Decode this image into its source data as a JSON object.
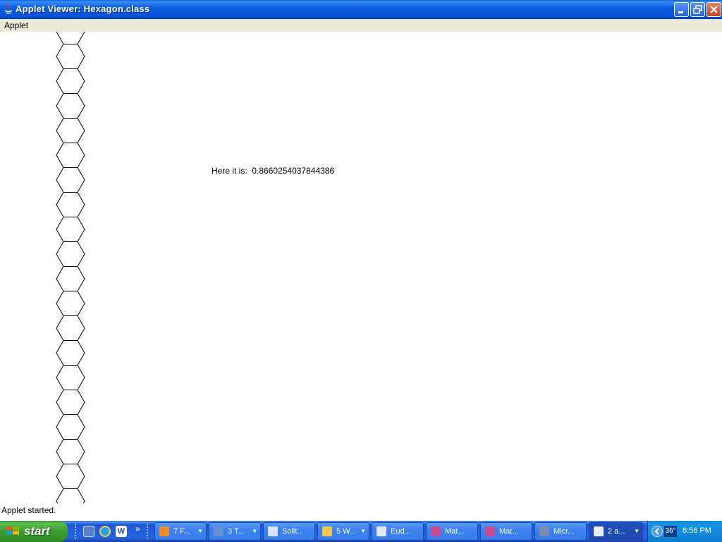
{
  "window": {
    "title": "Applet Viewer: Hexagon.class"
  },
  "menu": {
    "items": [
      "Applet"
    ]
  },
  "applet": {
    "readout_label": "Here it is:",
    "readout_value": "0.8660254037844386"
  },
  "status": {
    "text": "Applet started."
  },
  "taskbar": {
    "start_label": "start",
    "quick_launch": [
      "media-icon",
      "ie-icon",
      "word-icon"
    ],
    "chevron": "»",
    "buttons": [
      {
        "label": "7 F...",
        "icon": "firefox-icon",
        "has_arrow": true
      },
      {
        "label": "3 T...",
        "icon": "terminal-icon",
        "has_arrow": true
      },
      {
        "label": "Solit...",
        "icon": "solitaire-icon",
        "has_arrow": false
      },
      {
        "label": "5 W...",
        "icon": "folder-icon",
        "has_arrow": true
      },
      {
        "label": "Eud...",
        "icon": "eudora-icon",
        "has_arrow": false
      },
      {
        "label": "Mat...",
        "icon": "matlab-icon",
        "has_arrow": false
      },
      {
        "label": "Mat...",
        "icon": "matlab-icon",
        "has_arrow": false
      },
      {
        "label": "Micr...",
        "icon": "app-icon",
        "has_arrow": false
      },
      {
        "label": "2 a...",
        "icon": "window-icon",
        "has_arrow": true
      }
    ],
    "tray": {
      "temperature": "36°",
      "clock": "6:56 PM"
    }
  },
  "colors": {
    "titlebar": "#0b5ee0",
    "menubar": "#ece9d8",
    "taskbar": "#2663e0",
    "start": "#3a9d2f",
    "tray": "#0d7ed0"
  }
}
